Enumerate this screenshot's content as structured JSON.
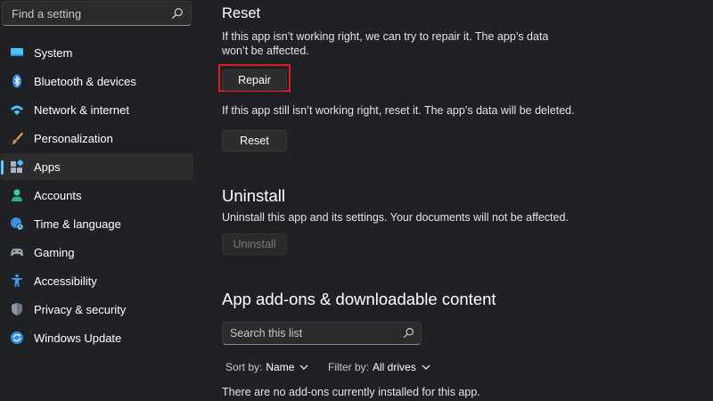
{
  "search": {
    "placeholder": "Find a setting"
  },
  "sidebar": {
    "items": [
      {
        "label": "System",
        "icon": "monitor-icon",
        "active": false
      },
      {
        "label": "Bluetooth & devices",
        "icon": "bluetooth-icon",
        "active": false
      },
      {
        "label": "Network & internet",
        "icon": "wifi-icon",
        "active": false
      },
      {
        "label": "Personalization",
        "icon": "brush-icon",
        "active": false
      },
      {
        "label": "Apps",
        "icon": "apps-icon",
        "active": true
      },
      {
        "label": "Accounts",
        "icon": "person-icon",
        "active": false
      },
      {
        "label": "Time & language",
        "icon": "globe-clock-icon",
        "active": false
      },
      {
        "label": "Gaming",
        "icon": "gamepad-icon",
        "active": false
      },
      {
        "label": "Accessibility",
        "icon": "accessibility-icon",
        "active": false
      },
      {
        "label": "Privacy & security",
        "icon": "shield-icon",
        "active": false
      },
      {
        "label": "Windows Update",
        "icon": "update-icon",
        "active": false
      }
    ]
  },
  "reset": {
    "title": "Reset",
    "repair_desc_line1": "If this app isn’t working right, we can try to repair it. The app’s data",
    "repair_desc_line2": "won’t be affected.",
    "repair_button": "Repair",
    "reset_desc": "If this app still isn’t working right, reset it. The app’s data will be deleted.",
    "reset_button": "Reset"
  },
  "uninstall": {
    "title": "Uninstall",
    "desc": "Uninstall this app and its settings. Your documents will not be affected.",
    "button": "Uninstall",
    "button_enabled": false
  },
  "addons": {
    "title": "App add-ons & downloadable content",
    "search_placeholder": "Search this list",
    "sort_label": "Sort by:",
    "sort_value": "Name",
    "filter_label": "Filter by:",
    "filter_value": "All drives",
    "empty_message": "There are no add-ons currently installed for this app."
  },
  "colors": {
    "background": "#202124",
    "accent": "#60cdff",
    "highlight_box": "#e11b22"
  }
}
